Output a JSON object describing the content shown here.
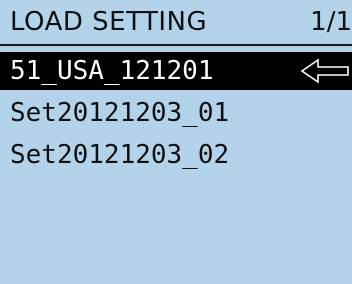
{
  "header": {
    "title": "LOAD SETTING",
    "page_indicator": "1/1"
  },
  "file_list": {
    "items": [
      {
        "label": "51_USA_121201",
        "selected": true
      },
      {
        "label": "Set20121203_01",
        "selected": false
      },
      {
        "label": "Set20121203_02",
        "selected": false
      }
    ]
  },
  "pointer": {
    "icon": "left-arrow-icon"
  },
  "colors": {
    "background": "#b3d3ea",
    "selection": "#000000",
    "text": "#111111",
    "selected_text": "#ffffff"
  }
}
